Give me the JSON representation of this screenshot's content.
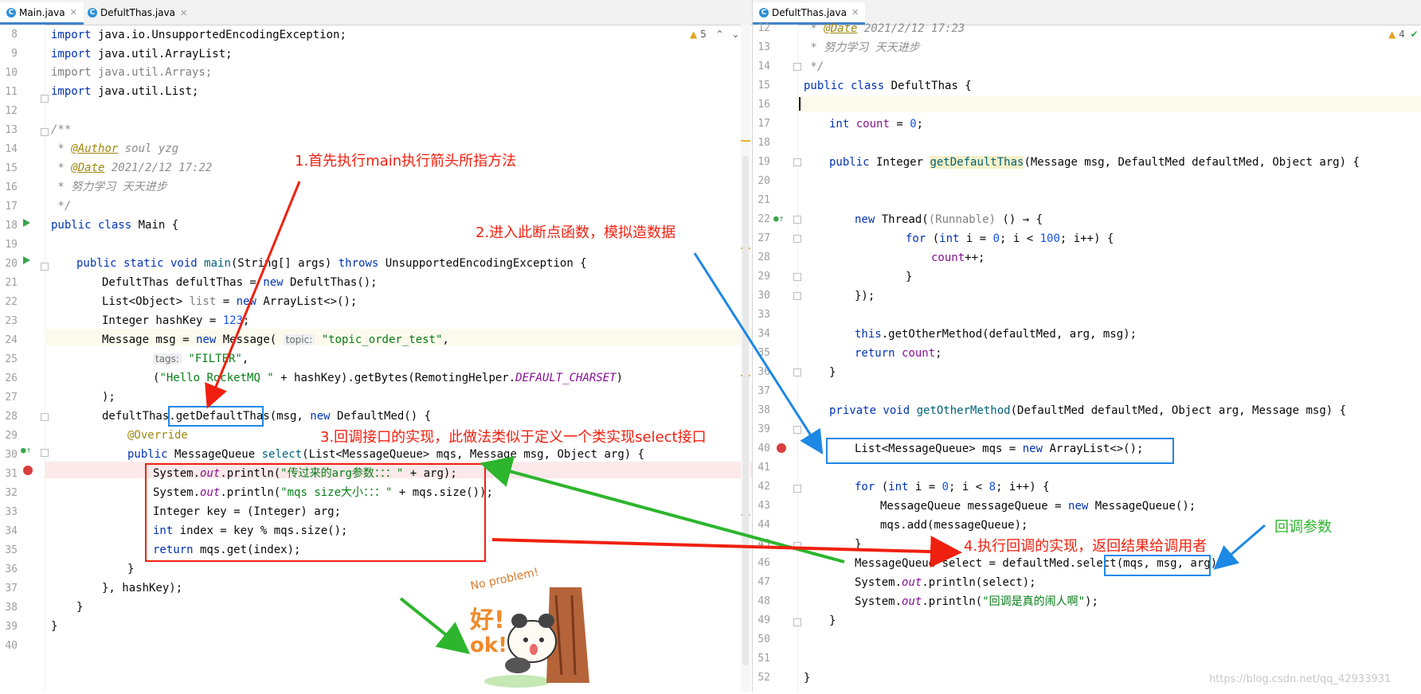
{
  "left_tabs": [
    {
      "label": "Main.java",
      "active": true
    },
    {
      "label": "DefultThas.java",
      "active": false
    }
  ],
  "right_tabs": [
    {
      "label": "DefultThas.java",
      "active": true
    }
  ],
  "left_warnings": "5",
  "right_warnings": "4",
  "left_line_numbers": [
    "8",
    "9",
    "10",
    "11",
    "12",
    "13",
    "14",
    "15",
    "16",
    "17",
    "18",
    "19",
    "20",
    "21",
    "22",
    "23",
    "24",
    "25",
    "26",
    "27",
    "28",
    "29",
    "30",
    "31",
    "32",
    "33",
    "34",
    "35",
    "36",
    "37",
    "38",
    "39",
    "40"
  ],
  "right_line_numbers": [
    "12",
    "13",
    "14",
    "15",
    "16",
    "17",
    "18",
    "19",
    "20",
    "21",
    "22",
    "27",
    "28",
    "29",
    "30",
    "33",
    "34",
    "35",
    "36",
    "37",
    "38",
    "39",
    "40",
    "41",
    "42",
    "43",
    "44",
    "45",
    "46",
    "47",
    "48",
    "49",
    "50",
    "51",
    "52"
  ],
  "annotations": {
    "note1": "1.首先执行main执行箭头所指方法",
    "note2": "2.进入此断点函数，模拟造数据",
    "note3": "3.回调接口的实现，此做法类似于定义一个类实现select接口",
    "note4": "4.执行回调的实现，返回结果给调用者",
    "note5": "回调参数"
  },
  "sticker": {
    "text1": "No problem!",
    "text2": "好!",
    "text3": "ok!"
  },
  "watermark": "https://blog.csdn.net/qq_42933931",
  "colors": {
    "keyword": "#0033b3",
    "string": "#067d17",
    "number": "#1750eb",
    "comment": "#8c8c8c",
    "annotation_red": "#f02010",
    "box_blue": "#1e88e5",
    "arrow_green": "#2db52d"
  }
}
